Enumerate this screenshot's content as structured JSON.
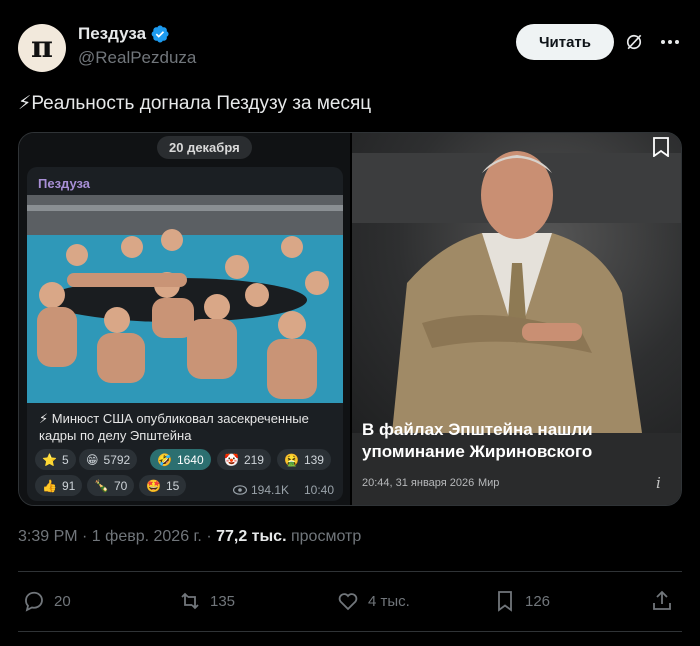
{
  "author": {
    "name": "Пездуза",
    "handle": "@RealPezduza",
    "avatar_letter": "п",
    "follow_label": "Читать"
  },
  "tweet": {
    "text": "⚡Реальность догнала Пездузу за месяц"
  },
  "left_card": {
    "date_pill": "20 декабря",
    "channel": "Пездуза",
    "caption": "⚡ Минюст США опубликовал засекреченные кадры по делу Эпштейна",
    "reactions": [
      {
        "emoji": "⭐",
        "count": "5"
      },
      {
        "emoji": "😁",
        "count": "5792"
      },
      {
        "emoji": "🤣",
        "count": "1640"
      },
      {
        "emoji": "🤡",
        "count": "219"
      },
      {
        "emoji": "🤮",
        "count": "139"
      },
      {
        "emoji": "👍",
        "count": "91"
      },
      {
        "emoji": "🍾",
        "count": "70"
      },
      {
        "emoji": "🤩",
        "count": "15"
      }
    ],
    "views": "194.1K",
    "time": "10:40"
  },
  "right_card": {
    "title": "В файлах Эпштейна нашли упоминание Жириновского",
    "timestamp": "20:44, 31 января 2026",
    "source": "Мир"
  },
  "meta": {
    "time_date": "3:39 PM · 1 февр. 2026 г. · ",
    "views_count": "77,2 тыс.",
    "views_label": " просмотр"
  },
  "actions": {
    "replies": "20",
    "reposts": "135",
    "likes": "4 тыс.",
    "bookmarks": "126"
  },
  "colors": {
    "background": "#000000",
    "verified": "#1d9bf0",
    "secondary_text": "#71767b",
    "active_reaction": "#2c6f70"
  }
}
